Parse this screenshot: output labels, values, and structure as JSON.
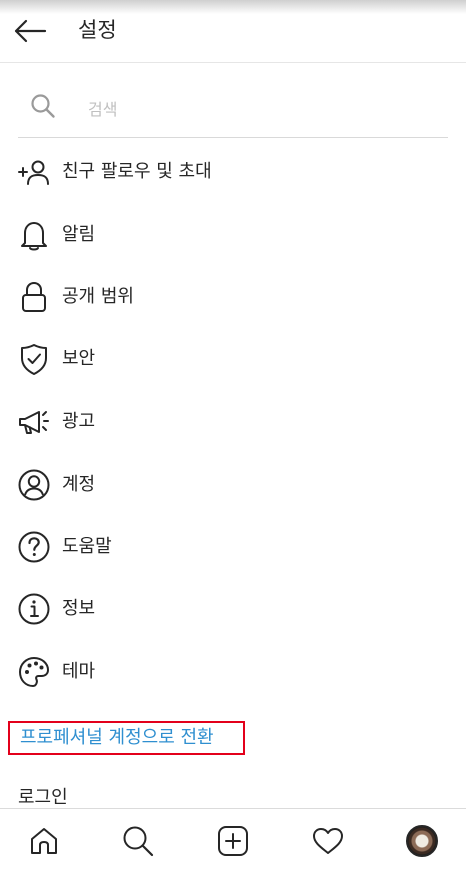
{
  "header": {
    "title": "설정",
    "back_icon": "arrow-left-icon"
  },
  "search": {
    "placeholder": "검색",
    "value": "",
    "icon": "search-icon"
  },
  "menu": [
    {
      "label": "친구 팔로우 및 초대",
      "icon": "add-person-icon"
    },
    {
      "label": "알림",
      "icon": "bell-icon"
    },
    {
      "label": "공개 범위",
      "icon": "lock-icon"
    },
    {
      "label": "보안",
      "icon": "shield-check-icon"
    },
    {
      "label": "광고",
      "icon": "megaphone-icon"
    },
    {
      "label": "계정",
      "icon": "account-circle-icon"
    },
    {
      "label": "도움말",
      "icon": "help-icon"
    },
    {
      "label": "정보",
      "icon": "info-icon"
    },
    {
      "label": "테마",
      "icon": "palette-icon"
    }
  ],
  "pro_switch_label": "프로페셔널 계정으로 전환",
  "login_label": "로그인",
  "bottom_nav": [
    "home-icon",
    "search-icon",
    "add-post-icon",
    "heart-icon",
    "profile-avatar"
  ],
  "colors": {
    "link": "#2f8fd0",
    "highlight_border": "#e3001b",
    "text": "#262626"
  }
}
